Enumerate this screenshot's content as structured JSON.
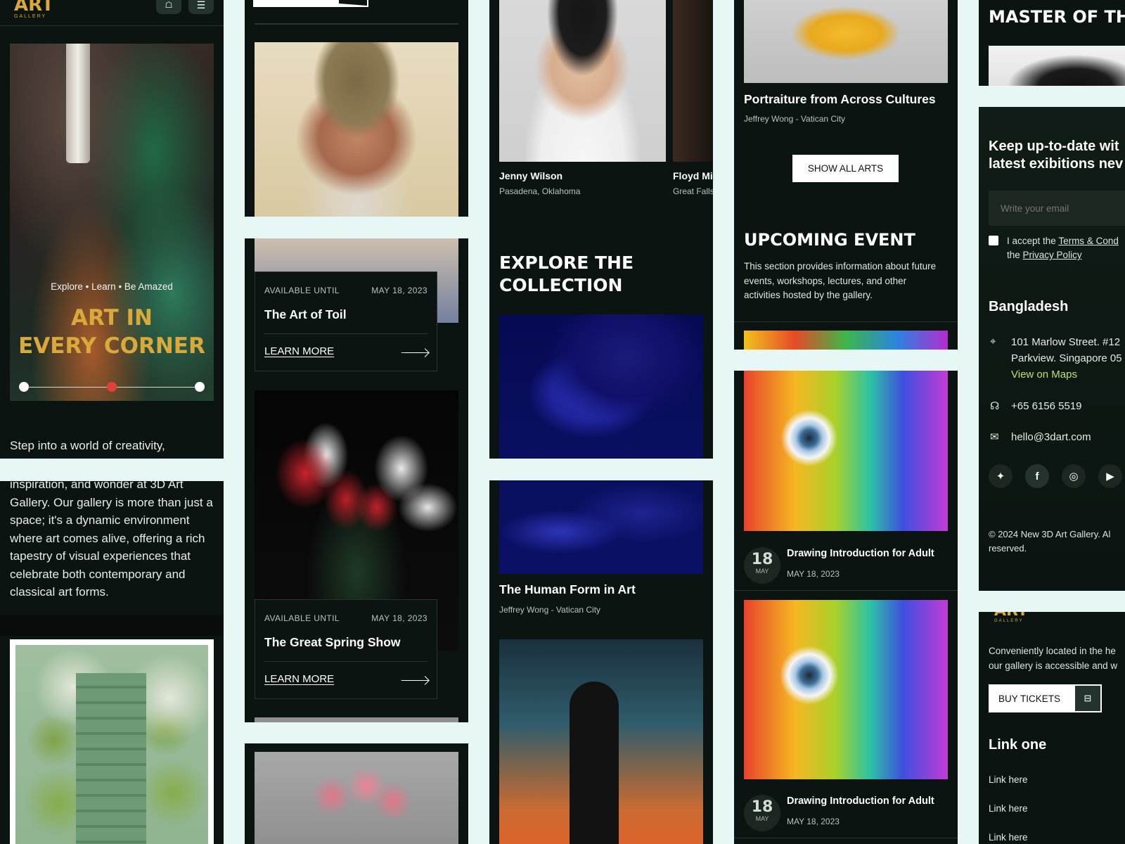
{
  "col1": {
    "logo": "ART",
    "logo_sub": "GALLERY",
    "hero_tagline": "Explore • Learn • Be Amazed",
    "hero_title_1": "ART IN",
    "hero_title_2": "EVERY CORNER",
    "intro_a": "Step into a world of creativity,",
    "intro_b": "inspiration, and wonder at 3D Art Gallery. Our gallery is more than just a space; it's a dynamic environment where art comes alive, offering a rich tapestry of visual experiences that celebrate both contemporary and classical art forms."
  },
  "col2": {
    "card1": {
      "available": "AVAILABLE UNTIL",
      "date": "MAY 18, 2023",
      "title": "The Art of Toil",
      "link": "LEARN MORE"
    },
    "card2": {
      "available": "AVAILABLE UNTIL",
      "date": "MAY 18, 2023",
      "title": "The Great Spring Show",
      "link": "LEARN MORE"
    }
  },
  "col3": {
    "artist1_name": "Jenny Wilson",
    "artist1_loc": "Pasadena, Oklahoma",
    "artist2_name": "Floyd Mil",
    "artist2_loc": "Great Falls",
    "explore_title_1": "EXPLORE THE",
    "explore_title_2": "COLLECTION",
    "art_title": "The Human Form in Art",
    "art_sub": "Jeffrey Wong - Vatican City"
  },
  "col4": {
    "art_title": "Portraiture from Across Cultures",
    "art_sub": "Jeffrey Wong - Vatican City",
    "show_all": "SHOW ALL ARTS",
    "event_title": "UPCOMING EVENT",
    "event_desc": "This section provides information about future events, workshops, lectures, and other activities hosted by the gallery.",
    "ev1": {
      "day": "18",
      "month": "MAY",
      "title": "Drawing Introduction for Adult",
      "date": "MAY 18, 2023"
    },
    "ev2": {
      "day": "18",
      "month": "MAY",
      "title": "Drawing Introduction for Adult",
      "date": "MAY 18, 2023"
    }
  },
  "col5": {
    "master_title": "MASTER OF THE",
    "news_title_1": "Keep up-to-date wit",
    "news_title_2": "latest exibitions nev",
    "email_placeholder": "Write your email",
    "accept_1": "I accept the",
    "terms_link": "Terms & Cond",
    "accept_2": "the",
    "privacy_link": "Privacy Policy",
    "country": "Bangladesh",
    "address_1": "101 Marlow Street. #12",
    "address_2": "Parkview. Singapore 05",
    "maps_link": "View on Maps",
    "phone": "+65 6156 5519",
    "email": "hello@3dart.com",
    "copyright_1": "© 2024 New 3D Art Gallery. Al",
    "copyright_2": "reserved.",
    "footer_logo": "ART",
    "footer_logo_sub": "GALLERY",
    "located_1": "Conveniently located in the he",
    "located_2": "our gallery is accessible and w",
    "buy_tickets": "BUY TICKETS",
    "link_heading": "Link one",
    "links": [
      "Link here",
      "Link here",
      "Link here"
    ]
  },
  "colors": {
    "accent_gold": "#d9a93b",
    "map_green": "#b9e36b",
    "dark_bg": "#0b1410",
    "page_bg": "#e6f7f5"
  }
}
